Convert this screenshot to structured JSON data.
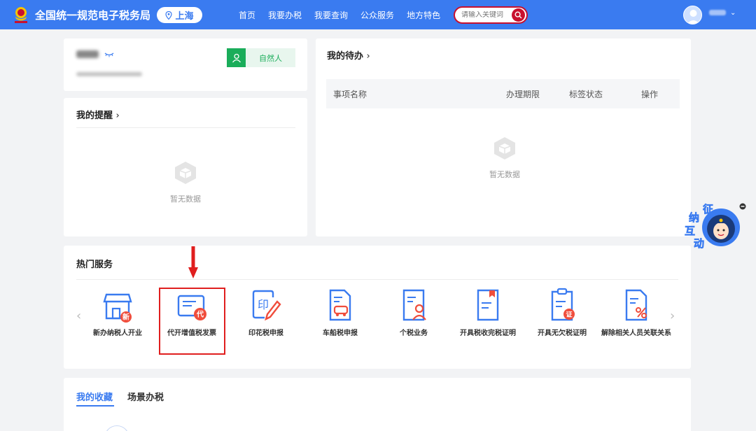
{
  "header": {
    "site_title": "全国统一规范电子税务局",
    "region": "上海",
    "nav": [
      "首页",
      "我要办税",
      "我要查询",
      "公众服务",
      "地方特色"
    ],
    "search_placeholder": "请输入关键词",
    "colors": {
      "bar": "#3a7bf0",
      "search_border": "#c8102e"
    }
  },
  "profile": {
    "user_type": "自然人"
  },
  "reminder": {
    "title": "我的提醒",
    "empty_text": "暂无数据"
  },
  "todo": {
    "title": "我的待办",
    "columns": [
      "事项名称",
      "办理期限",
      "标签状态",
      "操作"
    ],
    "empty_text": "暂无数据"
  },
  "hot_services": {
    "title": "热门服务",
    "items": [
      {
        "label": "新办纳税人开业",
        "icon": "new-taxpayer-icon",
        "badge": "新"
      },
      {
        "label": "代开增值税发票",
        "icon": "invoice-issue-icon",
        "badge": "代"
      },
      {
        "label": "印花税申报",
        "icon": "stamp-duty-icon",
        "badge": "印"
      },
      {
        "label": "车船税申报",
        "icon": "vehicle-tax-icon",
        "badge": ""
      },
      {
        "label": "个税业务",
        "icon": "personal-tax-icon",
        "badge": ""
      },
      {
        "label": "开具税收完税证明",
        "icon": "tax-certificate-icon",
        "badge": ""
      },
      {
        "label": "开具无欠税证明",
        "icon": "no-arrears-icon",
        "badge": "证"
      },
      {
        "label": "解除相关人员关联关系",
        "icon": "unlink-icon",
        "badge": ""
      }
    ]
  },
  "favorites": {
    "tabs": [
      "我的收藏",
      "场景办税"
    ]
  },
  "float_widget": {
    "chars": [
      "征",
      "纳",
      "互",
      "动"
    ]
  }
}
